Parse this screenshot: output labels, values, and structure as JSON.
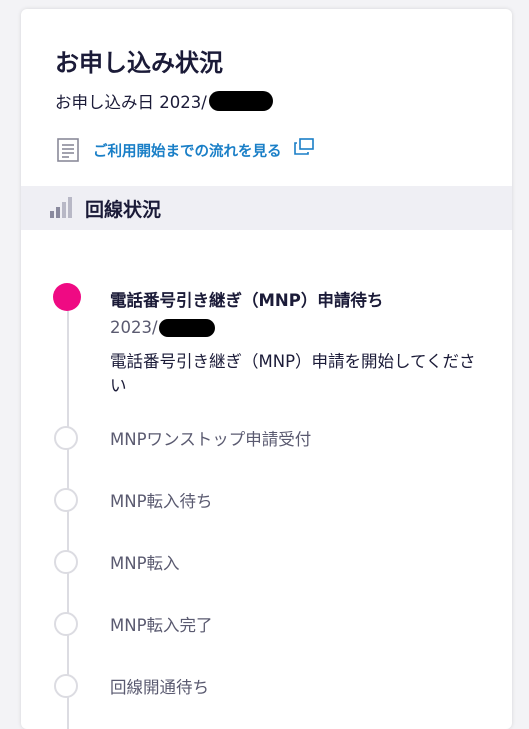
{
  "header": {
    "title": "お申し込み状況",
    "date_label": "お申し込み日 2023/"
  },
  "flow_link": {
    "label": "ご利用開始までの流れを見る",
    "icon": "document-icon",
    "external_icon": "external-window-icon"
  },
  "section": {
    "title": "回線状況",
    "icon": "signal-bars-icon"
  },
  "timeline": {
    "steps": [
      {
        "label": "電話番号引き継ぎ（MNP）申請待ち",
        "date": "2023/",
        "description": "電話番号引き継ぎ（MNP）申請を開始してください",
        "status": "active"
      },
      {
        "label": "MNPワンストップ申請受付",
        "status": "pending"
      },
      {
        "label": "MNP転入待ち",
        "status": "pending"
      },
      {
        "label": "MNP転入",
        "status": "pending"
      },
      {
        "label": "MNP転入完了",
        "status": "pending"
      },
      {
        "label": "回線開通待ち",
        "status": "pending"
      }
    ]
  },
  "colors": {
    "accent": "#ef0a83",
    "link": "#1a7fc7",
    "section_bg": "#efeff4"
  }
}
